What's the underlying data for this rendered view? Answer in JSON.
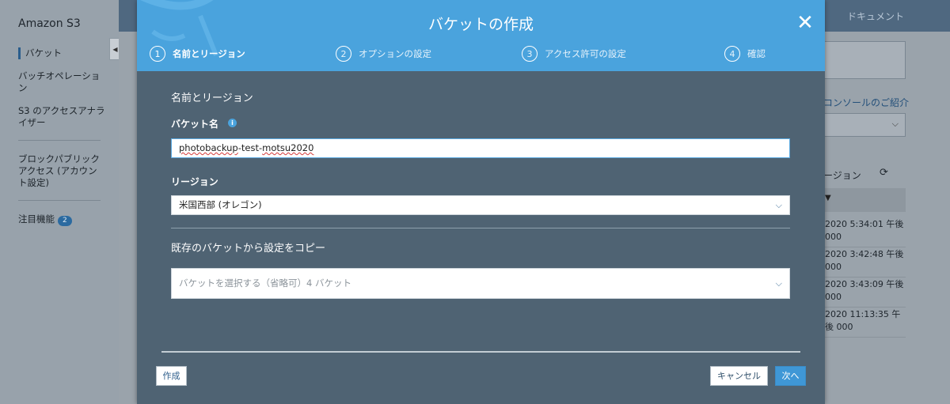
{
  "sidebar": {
    "brand": "Amazon S3",
    "items": [
      {
        "label": "バケット"
      },
      {
        "label": "バッチオペレーション"
      },
      {
        "label": "S3 のアクセスアナライザー"
      },
      {
        "label": "ブロックパブリックアクセス (アカウント設定)"
      },
      {
        "label": "注目機能",
        "badge": "2"
      }
    ],
    "collapse_icon": "triangle-left"
  },
  "background": {
    "doc_link": "ドキュメント",
    "console_intro": "コンソールのご紹介",
    "region_header": "ージョン",
    "rows": [
      "2020 5:34:01 午後 000",
      "2020 3:42:48 午後 000",
      "2020 3:43:09 午後 000",
      "2020 11:13:35 午後 000"
    ]
  },
  "modal": {
    "title": "バケットの作成",
    "steps": [
      {
        "number": "1",
        "label": "名前とリージョン"
      },
      {
        "number": "2",
        "label": "オプションの設定"
      },
      {
        "number": "3",
        "label": "アクセス許可の設定"
      },
      {
        "number": "4",
        "label": "確認"
      }
    ],
    "section_title": "名前とリージョン",
    "bucket_name_label": "バケット名",
    "bucket_name_parts": [
      "photobackup",
      "-test-",
      "motsu2020"
    ],
    "region_label": "リージョン",
    "region_value": "米国西部 (オレゴン)",
    "copy_label": "既存のバケットから設定をコピー",
    "copy_placeholder": "バケットを選択する（省略可）4 バケット",
    "buttons": {
      "create": "作成",
      "cancel": "キャンセル",
      "next": "次へ"
    }
  },
  "colors": {
    "header_blue": "#4aa3dd",
    "modal_body": "#4f6373",
    "next_button": "#3f97d6"
  }
}
